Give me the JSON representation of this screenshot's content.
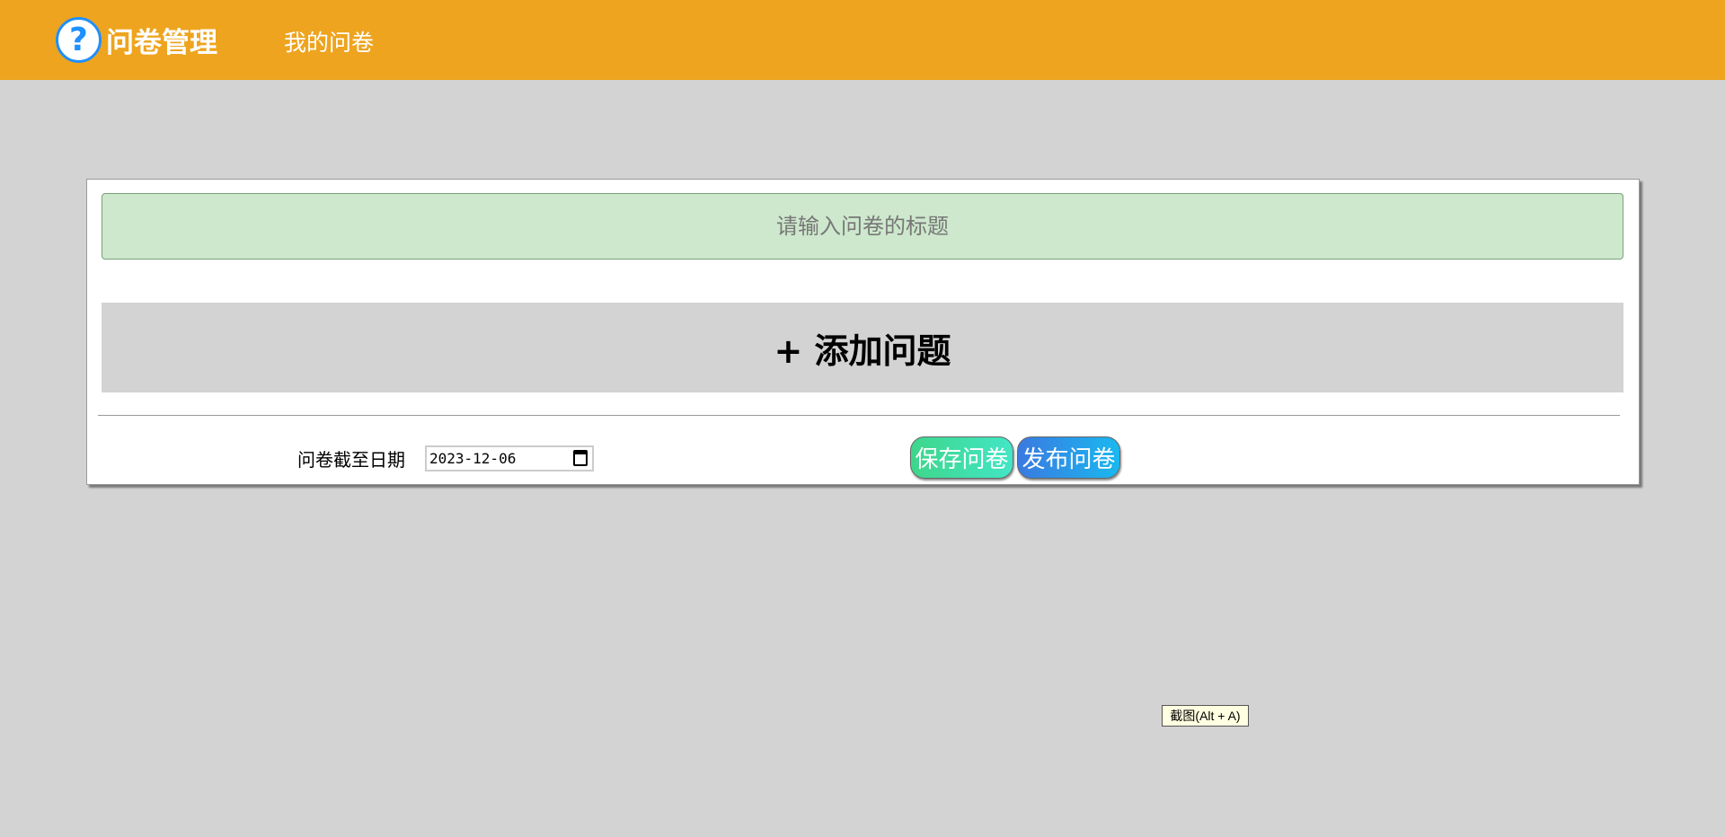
{
  "header": {
    "app_title": "问卷管理",
    "logo_icon": "question-mark-icon",
    "logo_glyph": "?",
    "nav_my_surveys": "我的问卷",
    "accent_color": "#eea41e"
  },
  "editor": {
    "title_placeholder": "请输入问卷的标题",
    "title_value": "",
    "add_question_label": "+ 添加问题",
    "deadline_label": "问卷截至日期",
    "deadline_value": "2023-12-06",
    "save_label": "保存问卷",
    "publish_label": "发布问卷"
  },
  "tooltip": {
    "text": "截图(Alt + A)"
  }
}
